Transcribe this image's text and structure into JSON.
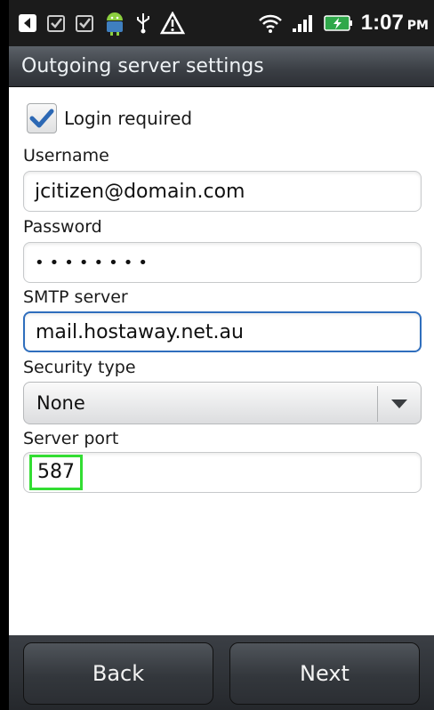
{
  "status_bar": {
    "time": "1:07",
    "ampm": "PM",
    "icons": [
      "back-arrow-icon",
      "checkbox-notification-icon",
      "checkbox-notification-icon",
      "android-icon",
      "usb-icon",
      "warning-icon",
      "wifi-icon",
      "signal-icon",
      "battery-charging-icon"
    ]
  },
  "title": "Outgoing server settings",
  "form": {
    "login_required": {
      "label": "Login required",
      "checked": true
    },
    "username": {
      "label": "Username",
      "value": "jcitizen@domain.com"
    },
    "password": {
      "label": "Password",
      "value": "••••••••"
    },
    "smtp": {
      "label": "SMTP server",
      "value": "mail.hostaway.net.au"
    },
    "security": {
      "label": "Security type",
      "value": "None"
    },
    "port": {
      "label": "Server port",
      "value": "587"
    }
  },
  "buttons": {
    "back": "Back",
    "next": "Next"
  },
  "colors": {
    "focus_border": "#2f6ebd",
    "highlight": "#33dd33",
    "check_blue": "#2c68b4"
  }
}
